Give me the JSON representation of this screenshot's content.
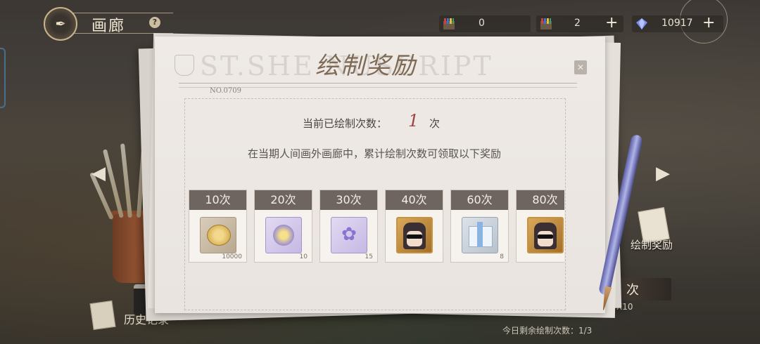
{
  "header": {
    "title": "画廊",
    "help_glyph": "?"
  },
  "resources": [
    {
      "id": "paint-tickets",
      "value": "0",
      "icon": "paint-set-icon"
    },
    {
      "id": "paint-tickets-2",
      "value": "2",
      "icon": "paint-set-icon"
    },
    {
      "id": "diamonds",
      "value": "10917",
      "icon": "diamond-icon"
    }
  ],
  "plus_glyph": "+",
  "dialog": {
    "title": "绘制奖励",
    "watermark": "ST.SHE          NUSCRIPT",
    "form_no": "NO.0709",
    "count_label": "当前已绘制次数：",
    "count_value": "1",
    "count_unit": "次",
    "description": "在当期人间画外画廊中，累计绘制次数可领取以下奖励",
    "close_glyph": "✕"
  },
  "rewards": [
    {
      "label": "10次",
      "qty": "10000",
      "kind": "coin"
    },
    {
      "label": "20次",
      "qty": "10",
      "kind": "sun-badge"
    },
    {
      "label": "30次",
      "qty": "15",
      "kind": "fairy"
    },
    {
      "label": "40次",
      "qty": "",
      "kind": "portrait"
    },
    {
      "label": "60次",
      "qty": "8",
      "kind": "gift"
    },
    {
      "label": "80次",
      "qty": "",
      "kind": "portrait"
    }
  ],
  "side": {
    "reward_entry_label": "绘制奖励",
    "draw_button_label": "次",
    "draw_multiplier": "X10",
    "remaining_label": "今日剩余绘制次数：1/3",
    "history_label": "历史记录",
    "arrow_left": "◀",
    "arrow_right": "▶"
  },
  "colors": {
    "count_value": "#9c4444",
    "tile_header": "#6e6561",
    "title": "#7d6a55"
  }
}
